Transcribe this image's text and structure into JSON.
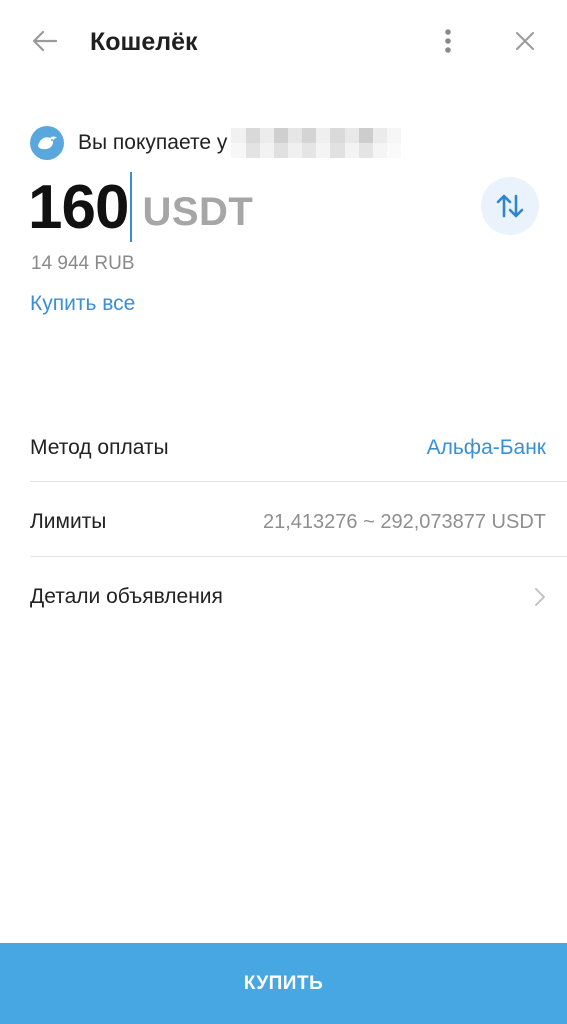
{
  "header": {
    "title": "Кошелёк",
    "back_icon": "arrow-left-icon",
    "more_icon": "more-vertical-icon",
    "close_icon": "close-icon"
  },
  "seller": {
    "prefix": "Вы покупаете у",
    "avatar_icon": "bird-avatar-icon",
    "name_redacted": true
  },
  "amount": {
    "value": "160",
    "currency": "USDT",
    "fiat_equivalent": "14 944 RUB",
    "buy_all_label": "Купить все",
    "swap_icon": "swap-vertical-icon"
  },
  "details": {
    "payment_method_label": "Метод оплаты",
    "payment_method_value": "Альфа-Банк",
    "limits_label": "Лимиты",
    "limits_value": "21,413276 ~ 292,073877 USDT",
    "ad_details_label": "Детали объявления",
    "ad_details_icon": "chevron-right-icon"
  },
  "buy_button_label": "КУПИТЬ",
  "colors": {
    "accent": "#3a8fd6",
    "button": "#47a7e3",
    "muted": "#8a8a8a"
  }
}
